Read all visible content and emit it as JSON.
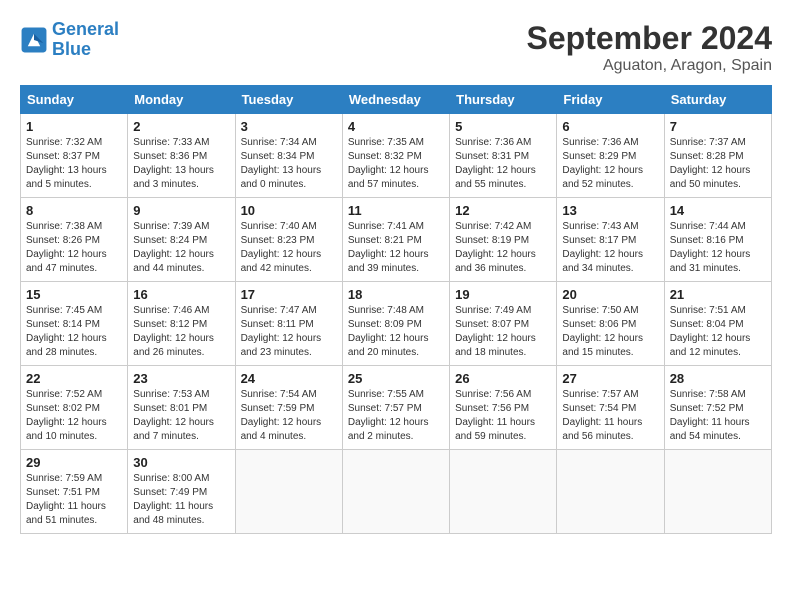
{
  "logo": {
    "line1": "General",
    "line2": "Blue"
  },
  "title": "September 2024",
  "location": "Aguaton, Aragon, Spain",
  "headers": [
    "Sunday",
    "Monday",
    "Tuesday",
    "Wednesday",
    "Thursday",
    "Friday",
    "Saturday"
  ],
  "weeks": [
    [
      {
        "day": "1",
        "sunrise": "7:32 AM",
        "sunset": "8:37 PM",
        "daylight": "13 hours and 5 minutes."
      },
      {
        "day": "2",
        "sunrise": "7:33 AM",
        "sunset": "8:36 PM",
        "daylight": "13 hours and 3 minutes."
      },
      {
        "day": "3",
        "sunrise": "7:34 AM",
        "sunset": "8:34 PM",
        "daylight": "13 hours and 0 minutes."
      },
      {
        "day": "4",
        "sunrise": "7:35 AM",
        "sunset": "8:32 PM",
        "daylight": "12 hours and 57 minutes."
      },
      {
        "day": "5",
        "sunrise": "7:36 AM",
        "sunset": "8:31 PM",
        "daylight": "12 hours and 55 minutes."
      },
      {
        "day": "6",
        "sunrise": "7:36 AM",
        "sunset": "8:29 PM",
        "daylight": "12 hours and 52 minutes."
      },
      {
        "day": "7",
        "sunrise": "7:37 AM",
        "sunset": "8:28 PM",
        "daylight": "12 hours and 50 minutes."
      }
    ],
    [
      {
        "day": "8",
        "sunrise": "7:38 AM",
        "sunset": "8:26 PM",
        "daylight": "12 hours and 47 minutes."
      },
      {
        "day": "9",
        "sunrise": "7:39 AM",
        "sunset": "8:24 PM",
        "daylight": "12 hours and 44 minutes."
      },
      {
        "day": "10",
        "sunrise": "7:40 AM",
        "sunset": "8:23 PM",
        "daylight": "12 hours and 42 minutes."
      },
      {
        "day": "11",
        "sunrise": "7:41 AM",
        "sunset": "8:21 PM",
        "daylight": "12 hours and 39 minutes."
      },
      {
        "day": "12",
        "sunrise": "7:42 AM",
        "sunset": "8:19 PM",
        "daylight": "12 hours and 36 minutes."
      },
      {
        "day": "13",
        "sunrise": "7:43 AM",
        "sunset": "8:17 PM",
        "daylight": "12 hours and 34 minutes."
      },
      {
        "day": "14",
        "sunrise": "7:44 AM",
        "sunset": "8:16 PM",
        "daylight": "12 hours and 31 minutes."
      }
    ],
    [
      {
        "day": "15",
        "sunrise": "7:45 AM",
        "sunset": "8:14 PM",
        "daylight": "12 hours and 28 minutes."
      },
      {
        "day": "16",
        "sunrise": "7:46 AM",
        "sunset": "8:12 PM",
        "daylight": "12 hours and 26 minutes."
      },
      {
        "day": "17",
        "sunrise": "7:47 AM",
        "sunset": "8:11 PM",
        "daylight": "12 hours and 23 minutes."
      },
      {
        "day": "18",
        "sunrise": "7:48 AM",
        "sunset": "8:09 PM",
        "daylight": "12 hours and 20 minutes."
      },
      {
        "day": "19",
        "sunrise": "7:49 AM",
        "sunset": "8:07 PM",
        "daylight": "12 hours and 18 minutes."
      },
      {
        "day": "20",
        "sunrise": "7:50 AM",
        "sunset": "8:06 PM",
        "daylight": "12 hours and 15 minutes."
      },
      {
        "day": "21",
        "sunrise": "7:51 AM",
        "sunset": "8:04 PM",
        "daylight": "12 hours and 12 minutes."
      }
    ],
    [
      {
        "day": "22",
        "sunrise": "7:52 AM",
        "sunset": "8:02 PM",
        "daylight": "12 hours and 10 minutes."
      },
      {
        "day": "23",
        "sunrise": "7:53 AM",
        "sunset": "8:01 PM",
        "daylight": "12 hours and 7 minutes."
      },
      {
        "day": "24",
        "sunrise": "7:54 AM",
        "sunset": "7:59 PM",
        "daylight": "12 hours and 4 minutes."
      },
      {
        "day": "25",
        "sunrise": "7:55 AM",
        "sunset": "7:57 PM",
        "daylight": "12 hours and 2 minutes."
      },
      {
        "day": "26",
        "sunrise": "7:56 AM",
        "sunset": "7:56 PM",
        "daylight": "11 hours and 59 minutes."
      },
      {
        "day": "27",
        "sunrise": "7:57 AM",
        "sunset": "7:54 PM",
        "daylight": "11 hours and 56 minutes."
      },
      {
        "day": "28",
        "sunrise": "7:58 AM",
        "sunset": "7:52 PM",
        "daylight": "11 hours and 54 minutes."
      }
    ],
    [
      {
        "day": "29",
        "sunrise": "7:59 AM",
        "sunset": "7:51 PM",
        "daylight": "11 hours and 51 minutes."
      },
      {
        "day": "30",
        "sunrise": "8:00 AM",
        "sunset": "7:49 PM",
        "daylight": "11 hours and 48 minutes."
      },
      null,
      null,
      null,
      null,
      null
    ]
  ]
}
